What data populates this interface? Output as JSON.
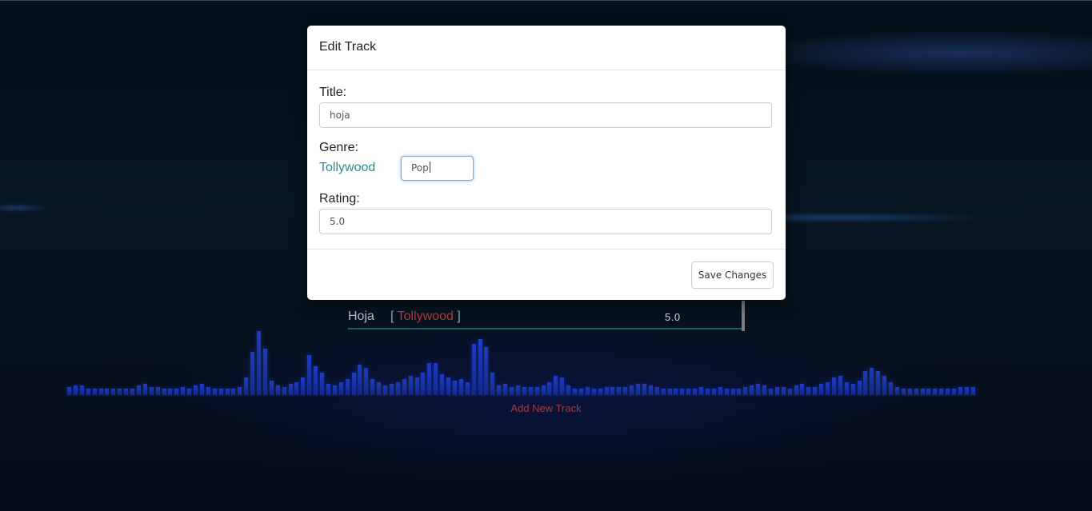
{
  "modal": {
    "title": "Edit Track",
    "title_label": "Title:",
    "title_value": "hoja",
    "genre_label": "Genre:",
    "current_genre": "Tollywood",
    "genre_value": "Pop",
    "rating_label": "Rating:",
    "rating_value": "5.0",
    "save_label": "Save Changes"
  },
  "tracks": [
    {
      "title": "Hoja",
      "bracket_open": "[",
      "genre": "Tollywood",
      "bracket_close": "]",
      "rating": "5.0"
    }
  ],
  "add_track_label": "Add New Track",
  "visualizer": {
    "levels": [
      10,
      12,
      12,
      8,
      8,
      8,
      8,
      8,
      8,
      8,
      8,
      12,
      14,
      10,
      10,
      8,
      8,
      8,
      10,
      8,
      12,
      14,
      10,
      8,
      8,
      8,
      8,
      10,
      22,
      54,
      80,
      58,
      18,
      12,
      10,
      14,
      16,
      22,
      50,
      36,
      28,
      14,
      12,
      16,
      20,
      28,
      38,
      34,
      20,
      16,
      12,
      14,
      16,
      20,
      24,
      22,
      28,
      40,
      40,
      26,
      22,
      18,
      20,
      16,
      64,
      70,
      60,
      28,
      12,
      14,
      10,
      12,
      10,
      10,
      10,
      12,
      16,
      24,
      22,
      12,
      8,
      8,
      10,
      8,
      8,
      10,
      10,
      10,
      10,
      12,
      14,
      14,
      12,
      10,
      8,
      8,
      8,
      8,
      8,
      8,
      10,
      8,
      8,
      10,
      8,
      8,
      8,
      10,
      12,
      14,
      12,
      8,
      10,
      10,
      8,
      12,
      14,
      10,
      10,
      14,
      16,
      22,
      24,
      16,
      14,
      18,
      30,
      34,
      30,
      24,
      16,
      10,
      8,
      8,
      8,
      8,
      8,
      8,
      8,
      8,
      8,
      10,
      10,
      10
    ]
  },
  "colors": {
    "accent_teal": "#2b8c8c",
    "genre_red": "#b13a3a",
    "add_track_red": "#a33a3a",
    "focus_blue": "#66afe9"
  }
}
